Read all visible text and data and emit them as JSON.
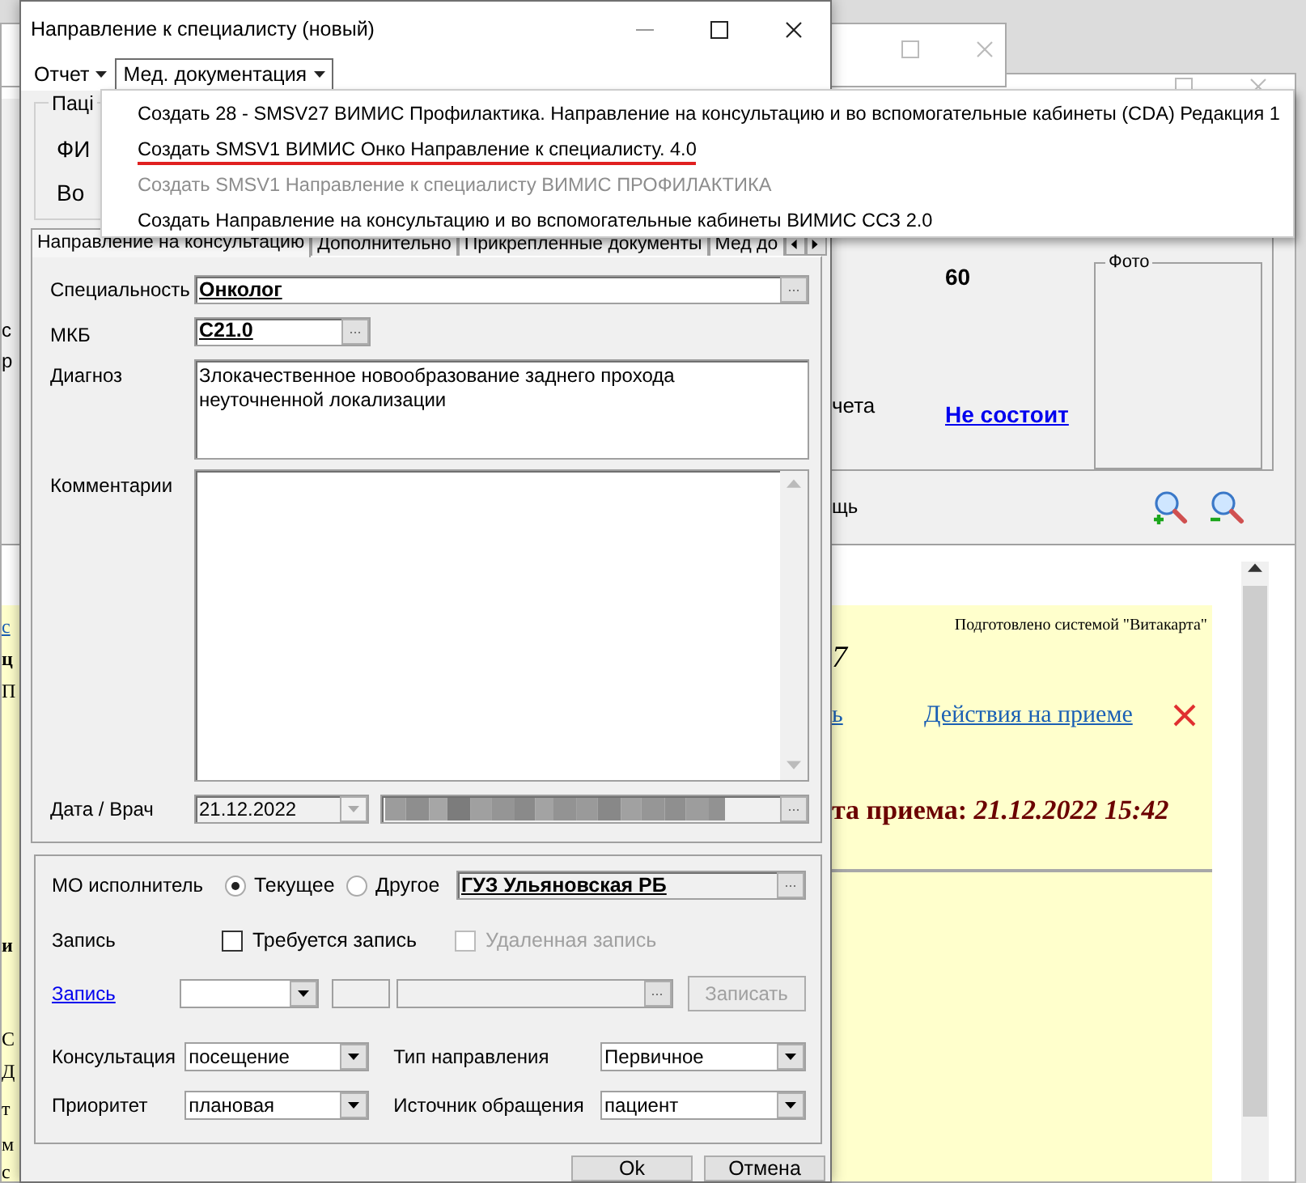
{
  "background": {
    "panel_fragments": [
      "с",
      "р"
    ],
    "info": {
      "value_1": "60",
      "partial_label": "чета",
      "status_link": "Не состоит",
      "photo_title": "Фото"
    },
    "toolbar": {
      "partial_label": "щь"
    },
    "document": {
      "credit": "Подготовлено системой \"Витакарта\"",
      "partial_number": "7",
      "partial_link": "ь",
      "actions_link": "Действия на приеме",
      "visit": "та приема: *21.12.2022 15:42*",
      "fragments": [
        {
          "text": "с",
          "kind": "link"
        },
        {
          "text": "ц",
          "kind": "bold"
        },
        {
          "text": "П",
          "kind": "plain"
        },
        {
          "text": "и",
          "kind": "bold"
        },
        {
          "text": "С",
          "kind": "plain"
        },
        {
          "text": "Д",
          "kind": "plain"
        },
        {
          "text": "т",
          "kind": "plain"
        },
        {
          "text": "м",
          "kind": "plain"
        },
        {
          "text": "с",
          "kind": "plain"
        }
      ]
    }
  },
  "dialog": {
    "title": "Направление к специалисту (новый)",
    "menu": [
      {
        "label": "Отчет",
        "selected": false
      },
      {
        "label": "Мед. документация",
        "selected": true
      }
    ],
    "dropdown": [
      {
        "label": "Создать 28 - SMSV27 ВИМИС Профилактика. Направление на консультацию и во вспомогательные кабинеты (CDA) Редакция 1",
        "disabled": false,
        "marked": false
      },
      {
        "label": "Создать SMSV1 ВИМИС Онко Направление к специалисту. 4.0",
        "disabled": false,
        "marked": true
      },
      {
        "label": "Создать SMSV1 Направление к специалисту ВИМИС ПРОФИЛАКТИКА",
        "disabled": true,
        "marked": false
      },
      {
        "label": "Создать Направление на консультацию и во вспомогательные кабинеты ВИМИС ССЗ 2.0",
        "disabled": false,
        "marked": false
      }
    ],
    "patient_group": {
      "title": "Паці",
      "rows": [
        "ФИ",
        "Во"
      ]
    },
    "tabs": [
      {
        "label": "Направление на консультацию",
        "selected": true
      },
      {
        "label": "Дополнительно",
        "selected": false
      },
      {
        "label": "Прикрепленные документы",
        "selected": false
      },
      {
        "label": "Мед до",
        "selected": false
      }
    ],
    "form": {
      "specialty": {
        "label": "Специальность",
        "value": "Онколог",
        "browse": "..."
      },
      "mkb": {
        "label": "МКБ",
        "value": "C21.0",
        "browse": "..."
      },
      "diagnosis": {
        "label": "Диагноз",
        "value": "Злокачественное новообразование заднего прохода неуточненной локализации"
      },
      "comments": {
        "label": "Комментарии"
      },
      "date_doctor": {
        "label": "Дата / Врач",
        "date": "21.12.2022",
        "browse": "..."
      }
    },
    "executor": {
      "label": "МО исполнитель",
      "options": [
        {
          "label": "Текущее",
          "selected": true
        },
        {
          "label": "Другое",
          "selected": false
        }
      ],
      "organization": "ГУЗ Ульяновская РБ",
      "browse": "..."
    },
    "record": {
      "label": "Запись",
      "checks": [
        {
          "label": "Требуется запись",
          "checked": false,
          "disabled": false
        },
        {
          "label": "Удаленная запись",
          "checked": false,
          "disabled": true
        }
      ]
    },
    "record_row": {
      "link": "Запись",
      "browse": "...",
      "button": {
        "label": "Записать",
        "disabled": true
      }
    },
    "selects": [
      {
        "label": "Консультация",
        "value": "посещение"
      },
      {
        "label": "Тип направления",
        "value": "Первичное"
      },
      {
        "label": "Приоритет",
        "value": "плановая"
      },
      {
        "label": "Источник обращения",
        "value": "пациент"
      }
    ],
    "buttons": [
      "Ok",
      "Отмена"
    ]
  }
}
